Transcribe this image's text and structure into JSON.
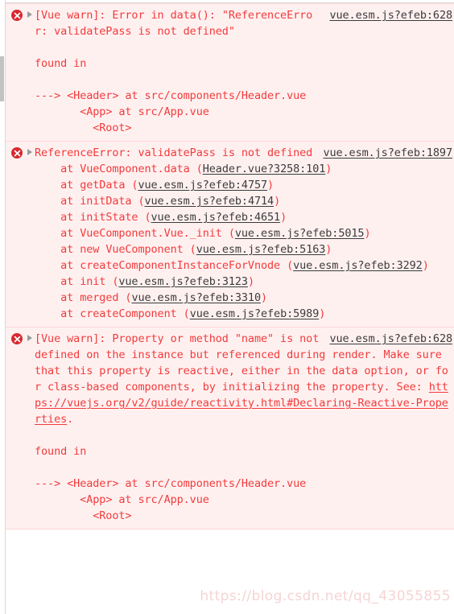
{
  "console": {
    "icon_name": "error-circle-x-icon",
    "disclosure_name": "disclosure-triangle-collapsed",
    "colors": {
      "message_text": "#f23b3b",
      "message_background": "#fff0f0",
      "source_link": "#3b3b3b",
      "error_icon": "#d8282f",
      "separator": "#ffd6d6",
      "scrollbar_thumb": "#c2c2c2",
      "watermark": "#f6d4d4"
    },
    "messages": [
      {
        "level": "error",
        "source": "vue.esm.js?efeb:628",
        "head": "[Vue warn]: Error in data(): ",
        "lines": [
          "\"ReferenceError: validatePass is not defined\"",
          "",
          "found in",
          "",
          "---> <Header> at src/components/Header.vue",
          "       <App> at src/App.vue",
          "         <Root>"
        ]
      },
      {
        "level": "error",
        "source": "vue.esm.js?efeb:1897",
        "head": "ReferenceError: validatePass ",
        "lines": [
          "is not defined"
        ],
        "stack": [
          {
            "fn": "    at VueComponent.data (",
            "link": "Header.vue?3258:101",
            "tail": ")"
          },
          {
            "fn": "    at getData (",
            "link": "vue.esm.js?efeb:4757",
            "tail": ")"
          },
          {
            "fn": "    at initData (",
            "link": "vue.esm.js?efeb:4714",
            "tail": ")"
          },
          {
            "fn": "    at initState (",
            "link": "vue.esm.js?efeb:4651",
            "tail": ")"
          },
          {
            "fn": "    at VueComponent.Vue._init (",
            "link": "vue.esm.js?efeb:5015",
            "tail": ")"
          },
          {
            "fn": "    at new VueComponent (",
            "link": "vue.esm.js?efeb:5163",
            "tail": ")"
          },
          {
            "fn": "    at createComponentInstanceForVnode (",
            "link": "vue.esm.js?efeb:3292",
            "tail": ")"
          },
          {
            "fn": "    at init (",
            "link": "vue.esm.js?efeb:3123",
            "tail": ")"
          },
          {
            "fn": "    at merged (",
            "link": "vue.esm.js?efeb:3310",
            "tail": ")"
          },
          {
            "fn": "    at createComponent (",
            "link": "vue.esm.js?efeb:5989",
            "tail": ")"
          }
        ]
      },
      {
        "level": "error",
        "source": "vue.esm.js?efeb:628",
        "head": "[Vue warn]: Property or method ",
        "body_before_link": "\"name\" is not defined on the instance but referenced during render. Make sure that this property is reactive, either in the data option, or for class-based components, by initializing the property. See: ",
        "doc_link": "https://vuejs.org/v2/guide/reactivity.html#Declaring-Reactive-Properties",
        "body_after_link": ".",
        "lines": [
          "",
          "found in",
          "",
          "---> <Header> at src/components/Header.vue",
          "       <App> at src/App.vue",
          "         <Root>"
        ]
      }
    ],
    "watermark": "https://blog.csdn.net/qq_43055855"
  }
}
